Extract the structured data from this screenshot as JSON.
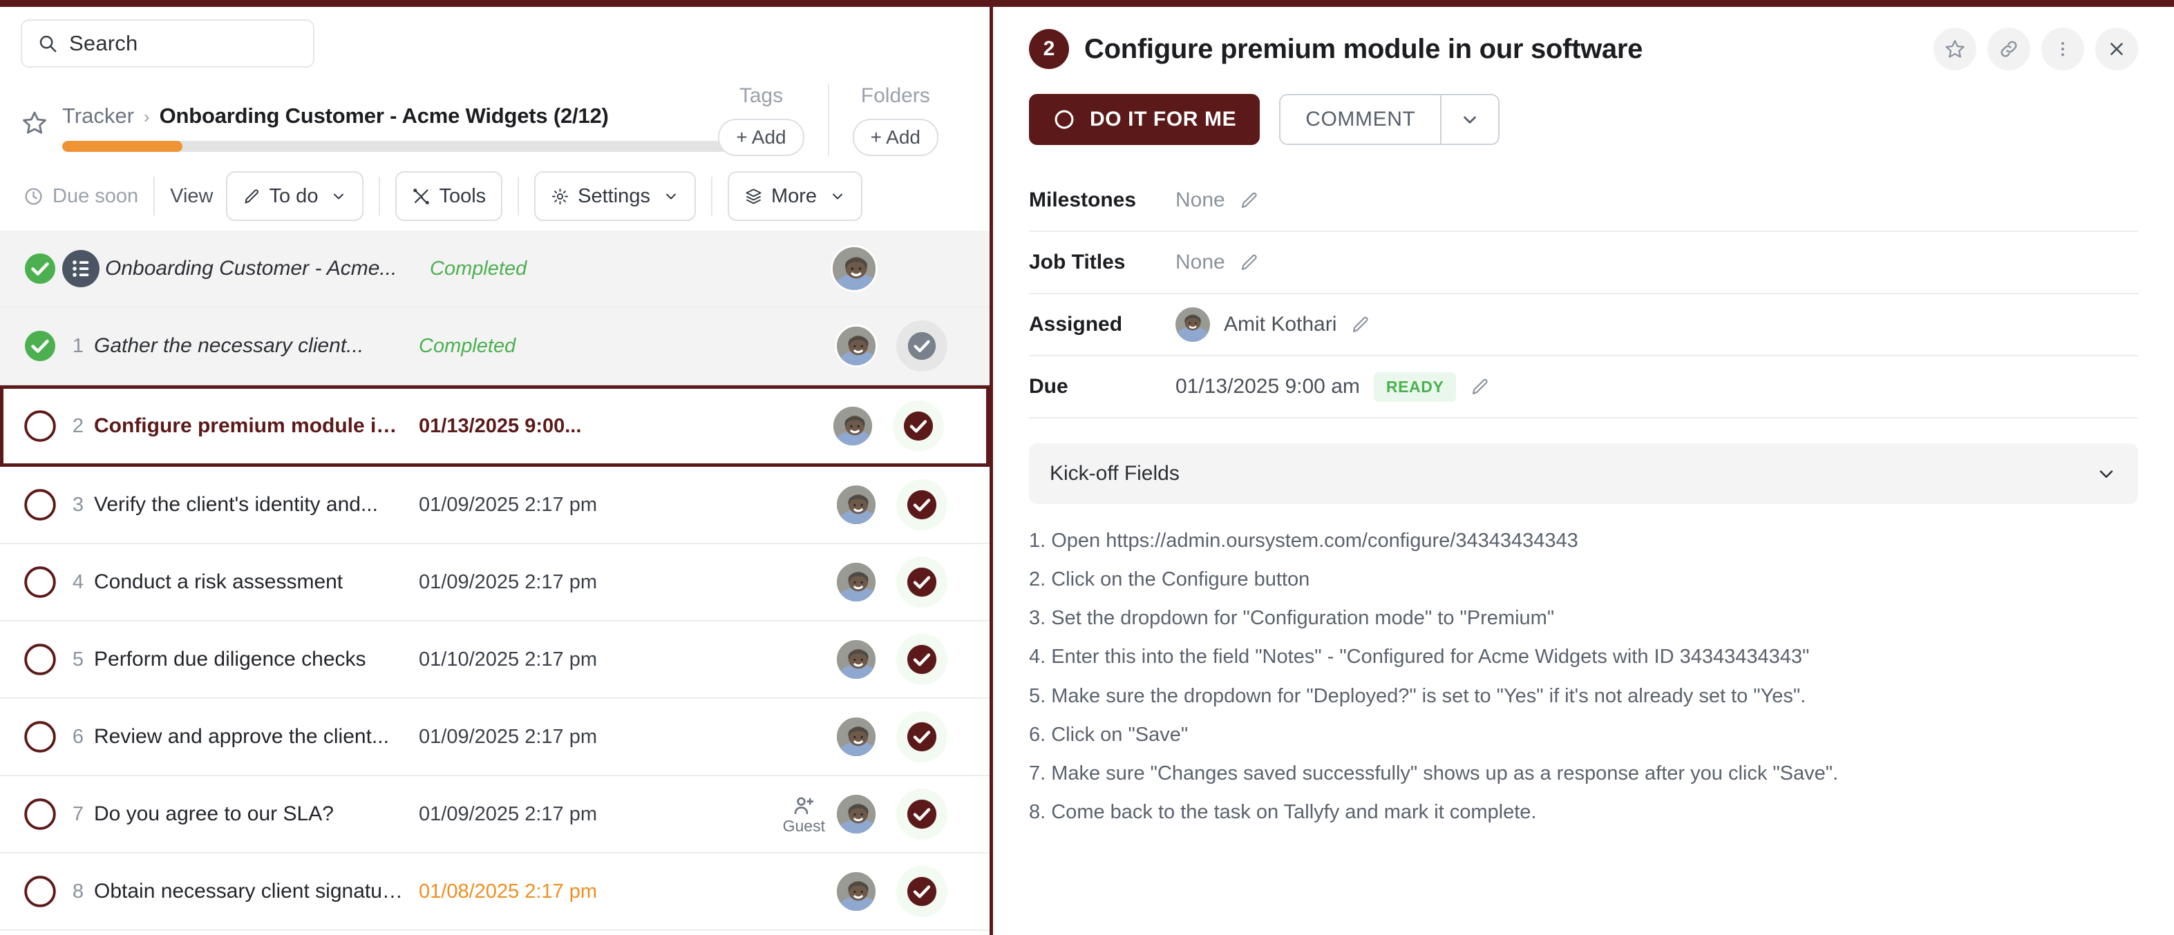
{
  "theme": {
    "brand_maroon": "#5c1919",
    "progress_orange": "#ef9434",
    "completed_green": "#4cb050",
    "overdue_orange": "#ef8f1f"
  },
  "search": {
    "placeholder": "Search",
    "value": "Search",
    "icon": "search-icon"
  },
  "breadcrumb": {
    "root": "Tracker",
    "separator": "›",
    "title": "Onboarding Customer - Acme Widgets (2/12)",
    "progress_percent": 17,
    "star_icon": "star-outline-icon"
  },
  "tags": {
    "label": "Tags",
    "add_label": "+ Add"
  },
  "folders": {
    "label": "Folders",
    "add_label": "+ Add"
  },
  "toolbar": {
    "due_soon": "Due soon",
    "due_soon_icon": "clock-icon",
    "view_label": "View",
    "todo_label": "To do",
    "todo_icon": "pencil-icon",
    "tools_label": "Tools",
    "tools_icon": "wrench-icon",
    "settings_label": "Settings",
    "settings_icon": "gear-icon",
    "more_label": "More",
    "more_icon": "layers-icon",
    "chevron_icon": "chevron-down-icon"
  },
  "task_list": [
    {
      "num": "",
      "title": "Onboarding Customer - Acme...",
      "status": "Completed",
      "state": "completed",
      "is_parent": true,
      "check": "green",
      "has_avatar": true,
      "avatar_big": true,
      "action": "none",
      "guest": false
    },
    {
      "num": "1",
      "title": "Gather the necessary client...",
      "status": "Completed",
      "state": "completed",
      "is_parent": false,
      "check": "green",
      "has_avatar": true,
      "avatar_big": false,
      "action": "grey",
      "guest": false
    },
    {
      "num": "2",
      "title": "Configure premium module in o...",
      "status": "01/13/2025 9:00...",
      "state": "selected",
      "is_parent": false,
      "check": "outline-maroon",
      "has_avatar": true,
      "avatar_big": false,
      "action": "maroon",
      "guest": false
    },
    {
      "num": "3",
      "title": "Verify the client's identity and...",
      "status": "01/09/2025 2:17 pm",
      "state": "normal",
      "is_parent": false,
      "check": "outline-maroon",
      "has_avatar": true,
      "avatar_big": false,
      "action": "maroon",
      "guest": false
    },
    {
      "num": "4",
      "title": "Conduct a risk assessment",
      "status": "01/09/2025 2:17 pm",
      "state": "normal",
      "is_parent": false,
      "check": "outline-maroon",
      "has_avatar": true,
      "avatar_big": false,
      "action": "maroon",
      "guest": false
    },
    {
      "num": "5",
      "title": "Perform due diligence checks",
      "status": "01/10/2025 2:17 pm",
      "state": "normal",
      "is_parent": false,
      "check": "outline-maroon",
      "has_avatar": true,
      "avatar_big": false,
      "action": "maroon",
      "guest": false
    },
    {
      "num": "6",
      "title": "Review and approve the client...",
      "status": "01/09/2025 2:17 pm",
      "state": "normal",
      "is_parent": false,
      "check": "outline-maroon",
      "has_avatar": true,
      "avatar_big": false,
      "action": "maroon",
      "guest": false
    },
    {
      "num": "7",
      "title": "Do you agree to our SLA?",
      "status": "01/09/2025 2:17 pm",
      "state": "normal",
      "is_parent": false,
      "check": "outline-maroon",
      "has_avatar": true,
      "avatar_big": false,
      "action": "maroon",
      "guest": true,
      "guest_label": "Guest"
    },
    {
      "num": "8",
      "title": "Obtain necessary client signatures",
      "status": "01/08/2025 2:17 pm",
      "state": "overdue",
      "is_parent": false,
      "check": "outline-maroon",
      "has_avatar": true,
      "avatar_big": false,
      "action": "maroon",
      "guest": false
    }
  ],
  "detail": {
    "badge": "2",
    "title": "Configure premium module in our software",
    "head_icons": [
      "star-outline-icon",
      "link-icon",
      "kebab-menu-icon",
      "close-icon"
    ],
    "primary_button": {
      "label": "DO IT FOR ME",
      "icon": "circle-outline-icon"
    },
    "comment_button": {
      "label": "COMMENT",
      "caret_icon": "chevron-down-icon"
    },
    "meta": [
      {
        "label": "Milestones",
        "value": "None",
        "muted": true,
        "edit_icon": "pencil-icon"
      },
      {
        "label": "Job Titles",
        "value": "None",
        "muted": true,
        "edit_icon": "pencil-icon"
      },
      {
        "label": "Assigned",
        "value": "Amit Kothari",
        "muted": false,
        "avatar": true,
        "edit_icon": "pencil-icon"
      },
      {
        "label": "Due",
        "value": "01/13/2025 9:00 am",
        "muted": false,
        "badge": "READY",
        "edit_icon": "pencil-icon"
      }
    ],
    "kickoff": {
      "title": "Kick-off Fields",
      "chevron_icon": "chevron-down-icon"
    },
    "steps": [
      "1. Open https://admin.oursystem.com/configure/34343434343",
      "2. Click on the Configure button",
      "3. Set the dropdown for \"Configuration mode\" to \"Premium\"",
      "4. Enter this into the field \"Notes\" - \"Configured for Acme Widgets with ID 34343434343\"",
      "5. Make sure the dropdown for \"Deployed?\" is set to \"Yes\" if it's not already set to \"Yes\".",
      "6. Click on \"Save\"",
      "7. Make sure \"Changes saved successfully\" shows up as a response after you click \"Save\".",
      "8. Come back to the task on Tallyfy and mark it complete."
    ]
  }
}
